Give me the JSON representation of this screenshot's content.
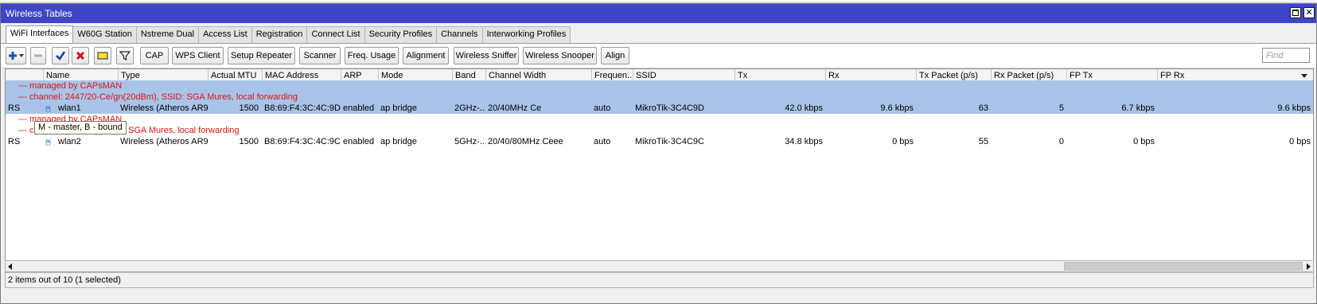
{
  "window": {
    "title": "Wireless Tables"
  },
  "tabs": [
    {
      "label": "WiFi Interfaces"
    },
    {
      "label": "W60G Station"
    },
    {
      "label": "Nstreme Dual"
    },
    {
      "label": "Access List"
    },
    {
      "label": "Registration"
    },
    {
      "label": "Connect List"
    },
    {
      "label": "Security Profiles"
    },
    {
      "label": "Channels"
    },
    {
      "label": "Interworking Profiles"
    }
  ],
  "toolbar": {
    "icons": {
      "add": "plus-icon",
      "remove": "minus-icon",
      "enable": "checkmark-icon",
      "disable": "x-icon",
      "comment": "note-icon",
      "filter": "funnel-icon"
    },
    "buttons": [
      "CAP",
      "WPS Client",
      "Setup Repeater",
      "Scanner",
      "Freq. Usage",
      "Alignment",
      "Wireless Sniffer",
      "Wireless Snooper",
      "Align"
    ],
    "find_placeholder": "Find"
  },
  "columns": [
    "Name",
    "Type",
    "Actual MTU",
    "MAC Address",
    "ARP",
    "Mode",
    "Band",
    "Channel Width",
    "Frequen...",
    "SSID",
    "Tx",
    "Rx",
    "Tx Packet (p/s)",
    "Rx Packet (p/s)",
    "FP Tx",
    "FP Rx"
  ],
  "rows": [
    {
      "kind": "comment",
      "text": "--- managed by CAPsMAN",
      "selected": true
    },
    {
      "kind": "comment",
      "text": "--- channel: 2447/20-Ce/gn(20dBm), SSID: SGA Mures, local forwarding",
      "selected": true
    },
    {
      "kind": "data",
      "selected": true,
      "flags": "RS",
      "name": "wlan1",
      "type": "Wireless (Atheros AR9...",
      "mtu": "1500",
      "mac": "B8:69:F4:3C:4C:9D",
      "arp": "enabled",
      "mode": "ap bridge",
      "band": "2GHz-...",
      "channel_width": "20/40MHz Ce",
      "frequency": "auto",
      "ssid": "MikroTik-3C4C9D",
      "tx": "42.0 kbps",
      "rx": "9.6 kbps",
      "tx_packet": "63",
      "rx_packet": "5",
      "fp_tx": "6.7 kbps",
      "fp_rx": "9.6 kbps"
    },
    {
      "kind": "comment",
      "text": "--- managed by CAPsMAN",
      "selected": false
    },
    {
      "kind": "comment",
      "text": "--- ch                sc/DP(27dBm), SSID: SGA Mures, local forwarding",
      "selected": false
    },
    {
      "kind": "data",
      "selected": false,
      "flags": "RS",
      "name": "wlan2",
      "type": "Wireless (Atheros AR9...",
      "mtu": "1500",
      "mac": "B8:69:F4:3C:4C:9C",
      "arp": "enabled",
      "mode": "ap bridge",
      "band": "5GHz-...",
      "channel_width": "20/40/80MHz Ceee",
      "frequency": "auto",
      "ssid": "MikroTik-3C4C9C",
      "tx": "34.8 kbps",
      "rx": "0 bps",
      "tx_packet": "55",
      "rx_packet": "0",
      "fp_tx": "0 bps",
      "fp_rx": "0 bps"
    }
  ],
  "tooltip": "M - master, B - bound",
  "status": "2 items out of 10 (1 selected)"
}
